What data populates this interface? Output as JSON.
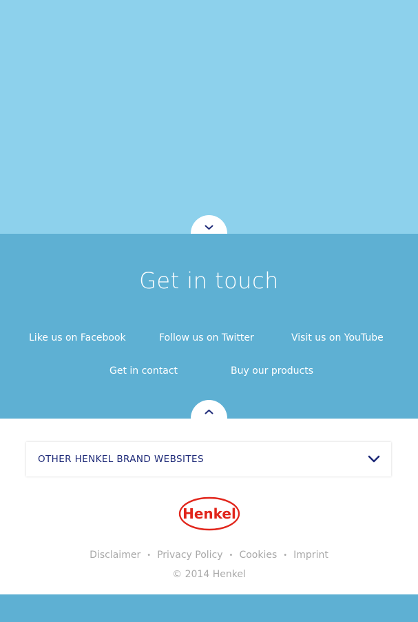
{
  "touch": {
    "title": "Get in touch",
    "links": [
      {
        "label": "Like us on Facebook"
      },
      {
        "label": "Follow us on Twitter"
      },
      {
        "label": "Visit us on YouTube"
      },
      {
        "label": "Get in contact"
      },
      {
        "label": "Buy our products"
      }
    ]
  },
  "footer": {
    "brand_dropdown_label": "OTHER HENKEL BRAND WEBSITES",
    "logo_text": "Henkel",
    "legal_links": [
      "Disclaimer",
      "Privacy Policy",
      "Cookies",
      "Imprint"
    ],
    "legal_separator": "•",
    "copyright": "© 2014 Henkel"
  },
  "icons": {
    "scroll_down": "chevron-down-icon",
    "scroll_up": "chevron-up-icon",
    "dropdown": "chevron-down-icon"
  },
  "colors": {
    "hero_bg": "#8dd1ec",
    "touch_bg": "#5eb0d3",
    "accent_navy": "#1e2a78",
    "henkel_red": "#e1251b",
    "muted_text": "#a9a9a9"
  }
}
